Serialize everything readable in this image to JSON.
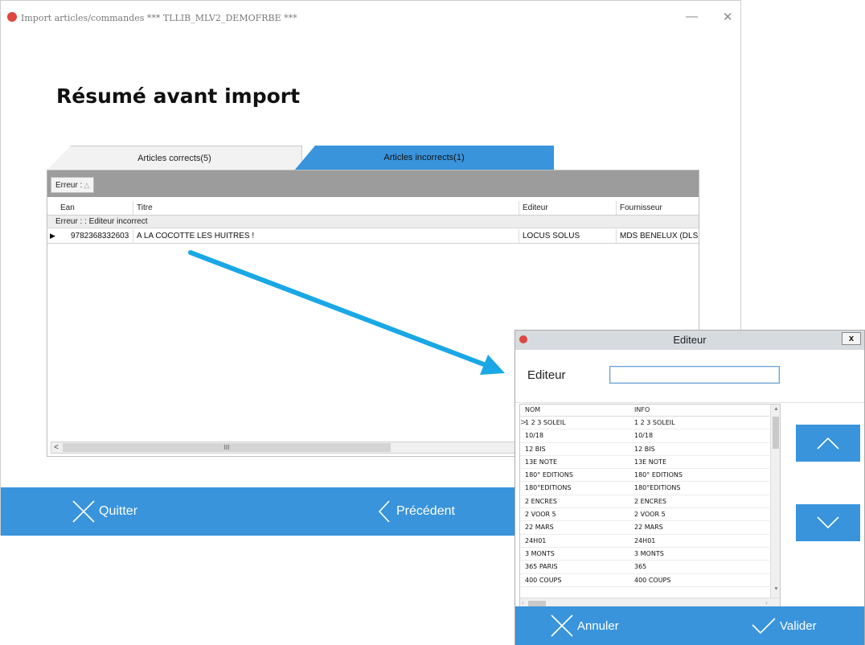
{
  "main_window": {
    "title": "Import articles/commandes  *** TLLIB_MLV2_DEMOFRBE ***",
    "minimize_glyph": "—",
    "close_glyph": "✕",
    "heading": "Résumé avant import",
    "tabs": [
      {
        "label": "Articles corrects(5)",
        "active": false
      },
      {
        "label": "Articles incorrects(1)",
        "active": true
      }
    ],
    "grid": {
      "group_chip": "Erreur :",
      "group_chip_sort": "△",
      "columns": [
        "Ean",
        "Titre",
        "Editeur",
        "Fournisseur"
      ],
      "group_row": "Erreur : : Editeur incorrect",
      "rows": [
        {
          "ean": "9782368332603",
          "titre": "A LA COCOTTE LES HUITRES !",
          "editeur": "LOCUS SOLUS",
          "fournisseur": "MDS BENELUX (DLS S"
        }
      ],
      "row_indicator": "▶",
      "hscroll_left": "<",
      "hscroll_thumb": "III"
    },
    "footer": {
      "quit_label": "Quitter",
      "prev_label": "Précédent"
    }
  },
  "editor_dialog": {
    "title": "Editeur",
    "close_label": "x",
    "field_label": "Editeur",
    "field_value": "",
    "list_columns": [
      "NOM",
      "INFO"
    ],
    "list_rows": [
      {
        "nom": "1 2 3 SOLEIL",
        "info": "1 2 3 SOLEIL"
      },
      {
        "nom": "10/18",
        "info": "10/18"
      },
      {
        "nom": "12 BIS",
        "info": "12 BIS"
      },
      {
        "nom": "13E NOTE",
        "info": "13E NOTE"
      },
      {
        "nom": "180° EDITIONS",
        "info": "180° EDITIONS"
      },
      {
        "nom": "180°EDITIONS",
        "info": "180°EDITIONS"
      },
      {
        "nom": "2 ENCRES",
        "info": "2 ENCRES"
      },
      {
        "nom": "2 VOOR 5",
        "info": "2 VOOR 5"
      },
      {
        "nom": "22 MARS",
        "info": "22 MARS"
      },
      {
        "nom": "24H01",
        "info": "24H01"
      },
      {
        "nom": "3 MONTS",
        "info": "3 MONTS"
      },
      {
        "nom": "365 PARIS",
        "info": "365"
      },
      {
        "nom": "400 COUPS",
        "info": "400 COUPS"
      }
    ],
    "row_indicator": ">",
    "cancel_label": "Annuler",
    "validate_label": "Valider"
  },
  "colors": {
    "accent": "#3994dc",
    "arrow": "#1aa7e6",
    "app_icon": "#e0463f"
  },
  "icons": [
    "app-icon",
    "close-x-icon",
    "chevron-left-icon",
    "chevron-up-icon",
    "chevron-down-icon",
    "checkmark-icon",
    "row-pointer-icon"
  ]
}
